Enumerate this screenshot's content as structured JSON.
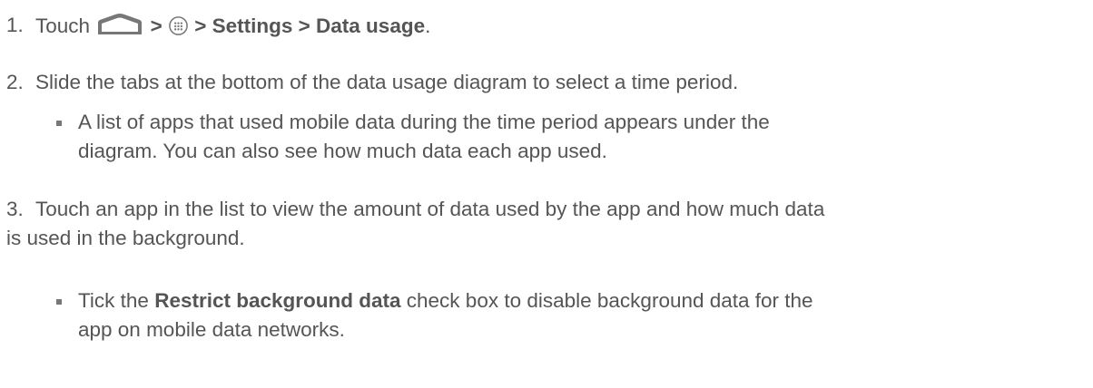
{
  "steps": [
    {
      "number": "1.",
      "parts": {
        "touch": "Touch",
        "sep1": ">",
        "sep2": "> Settings > Data usage",
        "end": "."
      },
      "icons": [
        "home-icon",
        "apps-icon"
      ]
    },
    {
      "number": "2.",
      "text": "Slide the tabs at the bottom of the data usage diagram to select a time period.",
      "bullet_lines": [
        "A list of apps that used mobile data during the time period appears under the",
        "diagram. You can also see how much data each app used."
      ]
    },
    {
      "number": "3.",
      "text_lines": [
        "Touch an app in the list to view the amount of data used by the app and how much data",
        "is used in the background."
      ],
      "bullet": {
        "pre": "Tick the",
        "bold": "Restrict background data",
        "post": "check box to disable background data for the",
        "line2": "app on mobile data networks."
      }
    }
  ],
  "colors": {
    "text": "#555555",
    "icon": "#777777"
  }
}
